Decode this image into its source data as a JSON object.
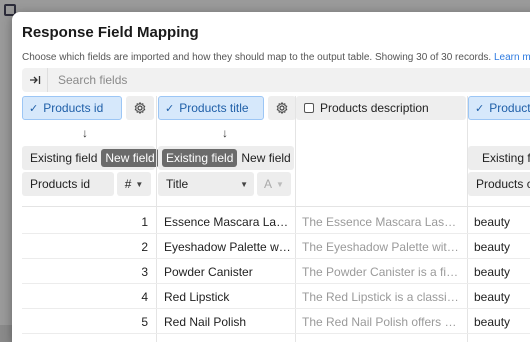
{
  "dialog": {
    "title": "Response Field Mapping",
    "description": "Choose which fields are imported and how they should map to the output table. Showing 30 of 30 records.",
    "learn_more": "Learn m"
  },
  "search": {
    "placeholder": "Search fields"
  },
  "columns": [
    {
      "header": "Products id",
      "selected": true,
      "toggle_left": "Existing field",
      "toggle_right": "New field",
      "active": "new",
      "mapped_name": "Products id",
      "type_icon": "#"
    },
    {
      "header": "Products title",
      "selected": true,
      "toggle_left": "Existing field",
      "toggle_right": "New field",
      "active": "existing",
      "mapped_name": "Title",
      "type_icon": "A"
    },
    {
      "header": "Products description",
      "selected": false
    },
    {
      "header": "Products",
      "selected": true,
      "toggle_left": "Existing fi",
      "mapped_name": "Products c"
    }
  ],
  "rows": [
    {
      "id": "1",
      "title": "Essence Mascara Lash…",
      "description": "The Essence Mascara Lash P…",
      "category": "beauty"
    },
    {
      "id": "2",
      "title": "Eyeshadow Palette wit…",
      "description": "The Eyeshadow Palette with …",
      "category": "beauty"
    },
    {
      "id": "3",
      "title": "Powder Canister",
      "description": "The Powder Canister is a fine…",
      "category": "beauty"
    },
    {
      "id": "4",
      "title": "Red Lipstick",
      "description": "The Red Lipstick is a classic …",
      "category": "beauty"
    },
    {
      "id": "5",
      "title": "Red Nail Polish",
      "description": "The Red Nail Polish offers a r…",
      "category": "beauty"
    }
  ],
  "colors": {
    "selected_header": "#d6e8fb",
    "toggle_active": "#6b6b6b",
    "link": "#2f7be0"
  }
}
